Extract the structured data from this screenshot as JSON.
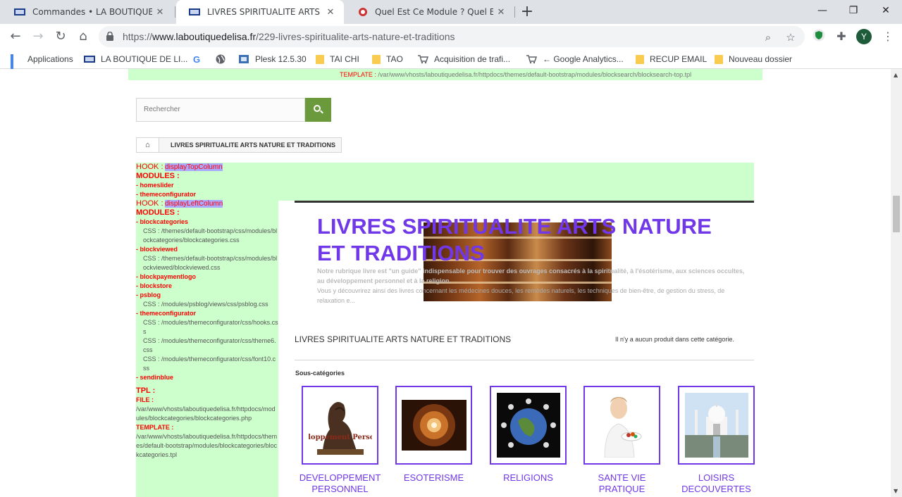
{
  "tabs": [
    {
      "title": "Commandes • LA BOUTIQUE DE LISA",
      "active": false
    },
    {
      "title": "LIVRES SPIRITUALITE ARTS NATURE ET TRADITIONS",
      "active": true
    },
    {
      "title": "Quel Est Ce Module ? Quel Est Ce Hook ?",
      "active": false
    }
  ],
  "omnibox": {
    "scheme": "https://",
    "host": "www.laboutiquedelisa.fr",
    "path": "/229-livres-spiritualite-arts-nature-et-traditions"
  },
  "profile_initial": "Y",
  "bookmarks": [
    {
      "label": "Applications",
      "icon": "apps-icon"
    },
    {
      "label": "LA BOUTIQUE DE LI...",
      "icon": "site-icon"
    },
    {
      "label": "",
      "icon": "google-icon"
    },
    {
      "label": "",
      "icon": "globe-icon"
    },
    {
      "label": "Plesk 12.5.30",
      "icon": "plesk-icon"
    },
    {
      "label": "TAI CHI",
      "icon": "folder-icon"
    },
    {
      "label": "TAO",
      "icon": "folder-icon"
    },
    {
      "label": "Acquisition de trafi...",
      "icon": "cart-icon"
    },
    {
      "label": "← Google Analytics...",
      "icon": "cart-icon"
    },
    {
      "label": "RECUP EMAIL",
      "icon": "folder-icon"
    },
    {
      "label": "Nouveau dossier",
      "icon": "folder-icon"
    }
  ],
  "page": {
    "top_debug": {
      "label": "TEMPLATE :",
      "value": "/var/www/vhosts/laboutiquedelisa.fr/httpdocs/themes/default-bootstrap/modules/blocksearch/blocksearch-top.tpl"
    },
    "search_placeholder": "Rechercher",
    "breadcrumb": "LIVRES SPIRITUALITE ARTS NATURE ET TRADITIONS",
    "debug": {
      "hook1_label": "HOOK :",
      "hook1_name": "displayTopColumn",
      "modules_label": "MODULES :",
      "hook1_modules": [
        "- homeslider",
        "- themeconfigurator"
      ],
      "hook2_label": "HOOK :",
      "hook2_name": "displayLeftColumn",
      "modules2_label": "MODULES :",
      "m_blockcategories": "- blockcategories",
      "css_blockcategories": "CSS : /themes/default-bootstrap/css/modules/blockcategories/blockcategories.css",
      "m_blockviewed": "- blockviewed",
      "css_blockviewed": "CSS : /themes/default-bootstrap/css/modules/blockviewed/blockviewed.css",
      "m_blockpaymentlogo": "- blockpaymentlogo",
      "m_blockstore": "- blockstore",
      "m_psblog": "- psblog",
      "css_psblog": "CSS : /modules/psblog/views/css/psblog.css",
      "m_themeconfigurator": "- themeconfigurator",
      "css_tc1": "CSS : /modules/themeconfigurator/css/hooks.css",
      "css_tc2": "CSS : /modules/themeconfigurator/css/theme6.css",
      "css_tc3": "CSS : /modules/themeconfigurator/css/font10.css",
      "m_sendinblue": "- sendinblue",
      "tpl_label": "TPL :",
      "file_label": "FILE :",
      "file_value": "/var/www/vhosts/laboutiquedelisa.fr/httpdocs/modules/blockcategories/blockcategories.php",
      "template_label": "TEMPLATE :",
      "template_value": "/var/www/vhosts/laboutiquedelisa.fr/httpdocs/themes/default-bootstrap/modules/blockcategories/blockcategories.tpl"
    },
    "category_title": "LIVRES SPIRITUALITE ARTS NATURE ET TRADITIONS",
    "category_desc_1": "Notre rubrique livre est \"un guide\" indispensable pour trouver des ouvrages consacrés à la spiritualité, à l'ésotérisme, aux sciences occultes, au développement personnel et à la religion.",
    "category_desc_2": "Vous y découvrirez ainsi des livres concernant les médecines douces, les remèdes naturels, les techniques de bien-être, de gestion du stress, de relaxation e...",
    "listing_title": "LIVRES SPIRITUALITE ARTS NATURE ET TRADITIONS",
    "no_products": "Il n'y a aucun produit dans cette catégorie.",
    "subcategories_label": "Sous-catégories",
    "subcategories": [
      {
        "name": "DEVELOPPEMENT PERSONNEL",
        "thumb_caption": "Développement Personnel"
      },
      {
        "name": "ESOTERISME"
      },
      {
        "name": "RELIGIONS"
      },
      {
        "name": "SANTE VIE PRATIQUE"
      },
      {
        "name": "LOISIRS DECOUVERTES"
      }
    ]
  },
  "colors": {
    "accent": "#7038e8",
    "debug_bg": "#ccffcc",
    "debug_text": "#ff0000",
    "search_button": "#6b9a3c"
  }
}
